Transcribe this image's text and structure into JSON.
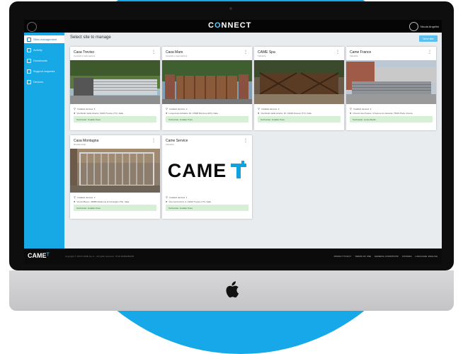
{
  "app": {
    "brand_prefix": "C",
    "brand_mark": "O",
    "brand_suffix": "NNECT",
    "user_name": "Nicola Angelini"
  },
  "sidebar": {
    "items": [
      {
        "label": "Sites management",
        "icon": "sites-icon",
        "active": true
      },
      {
        "label": "Activity",
        "icon": "activity-icon",
        "active": false
      },
      {
        "label": "Downloads",
        "icon": "downloads-icon",
        "active": false
      },
      {
        "label": "Support requests",
        "icon": "support-icon",
        "active": false
      },
      {
        "label": "Devices",
        "icon": "devices-icon",
        "active": false
      }
    ]
  },
  "main": {
    "title": "Select site to manage",
    "new_site_label": "New site"
  },
  "cards": [
    {
      "name": "Casa Treviso",
      "subtitle": "Cancelli e Automazioni",
      "installed": "Installed devices: 5",
      "address": "Via Martiri della Libertà, 31100 Treviso (TV), Italia",
      "technician": "Technician: Installer Pass",
      "image": "gate-1"
    },
    {
      "name": "Casa Mare",
      "subtitle": "Cancelli e Automazioni",
      "installed": "Installed devices: 3",
      "address": "Lungomare Adriatico 30, 47838 Riccione (RN), Italia",
      "technician": "Technician: Installer Pass",
      "image": "gate-2"
    },
    {
      "name": "CAME Spa",
      "subtitle": "Industria",
      "installed": "Installed devices: 2",
      "address": "Via Martiri della Libertà, 15, 31030 Dosson (TV), Italia",
      "technician": "Technician: Installer Pass",
      "image": "gate-3"
    },
    {
      "name": "Came France",
      "subtitle": "Industria",
      "installed": "Installed devices: 4",
      "address": "Chemin des Postes, 3 Avenue du Général, 75001 Paris, France",
      "technician": "Technician: Lucas Martin",
      "image": "gate-4"
    },
    {
      "name": "Casa Montagna",
      "subtitle": "Residenziale",
      "installed": "Installed devices: 2",
      "address": "Via del Bosco, 38086 Madonna di Campiglio (TN), Italia",
      "technician": "Technician: Installer Pass",
      "image": "gate-5"
    },
    {
      "name": "Came Service",
      "subtitle": "Industria",
      "installed": "Installed devices: 1",
      "address": "Via Cornia Nord, 3, 31100 Treviso (TV), Italia",
      "technician": "Technician: Installer Pass",
      "image": "came-logo",
      "logo_text": "CAME"
    }
  ],
  "footer": {
    "logo": "CAME",
    "copyright": "Copyright © 2018 CAME S.p.A. - All rights reserved - P.IVA 03481280265",
    "links": [
      "PRIVACY POLICY",
      "TERMS OF USE",
      "GENERAL CONDITIONS",
      "COOKIES",
      "LANGUAGE: ENGLISH"
    ]
  },
  "colors": {
    "accent": "#16a8e8",
    "sidebar": "#17a9e6",
    "technician_bg": "#d6efd6",
    "came_blue": "#0ea2e0"
  }
}
